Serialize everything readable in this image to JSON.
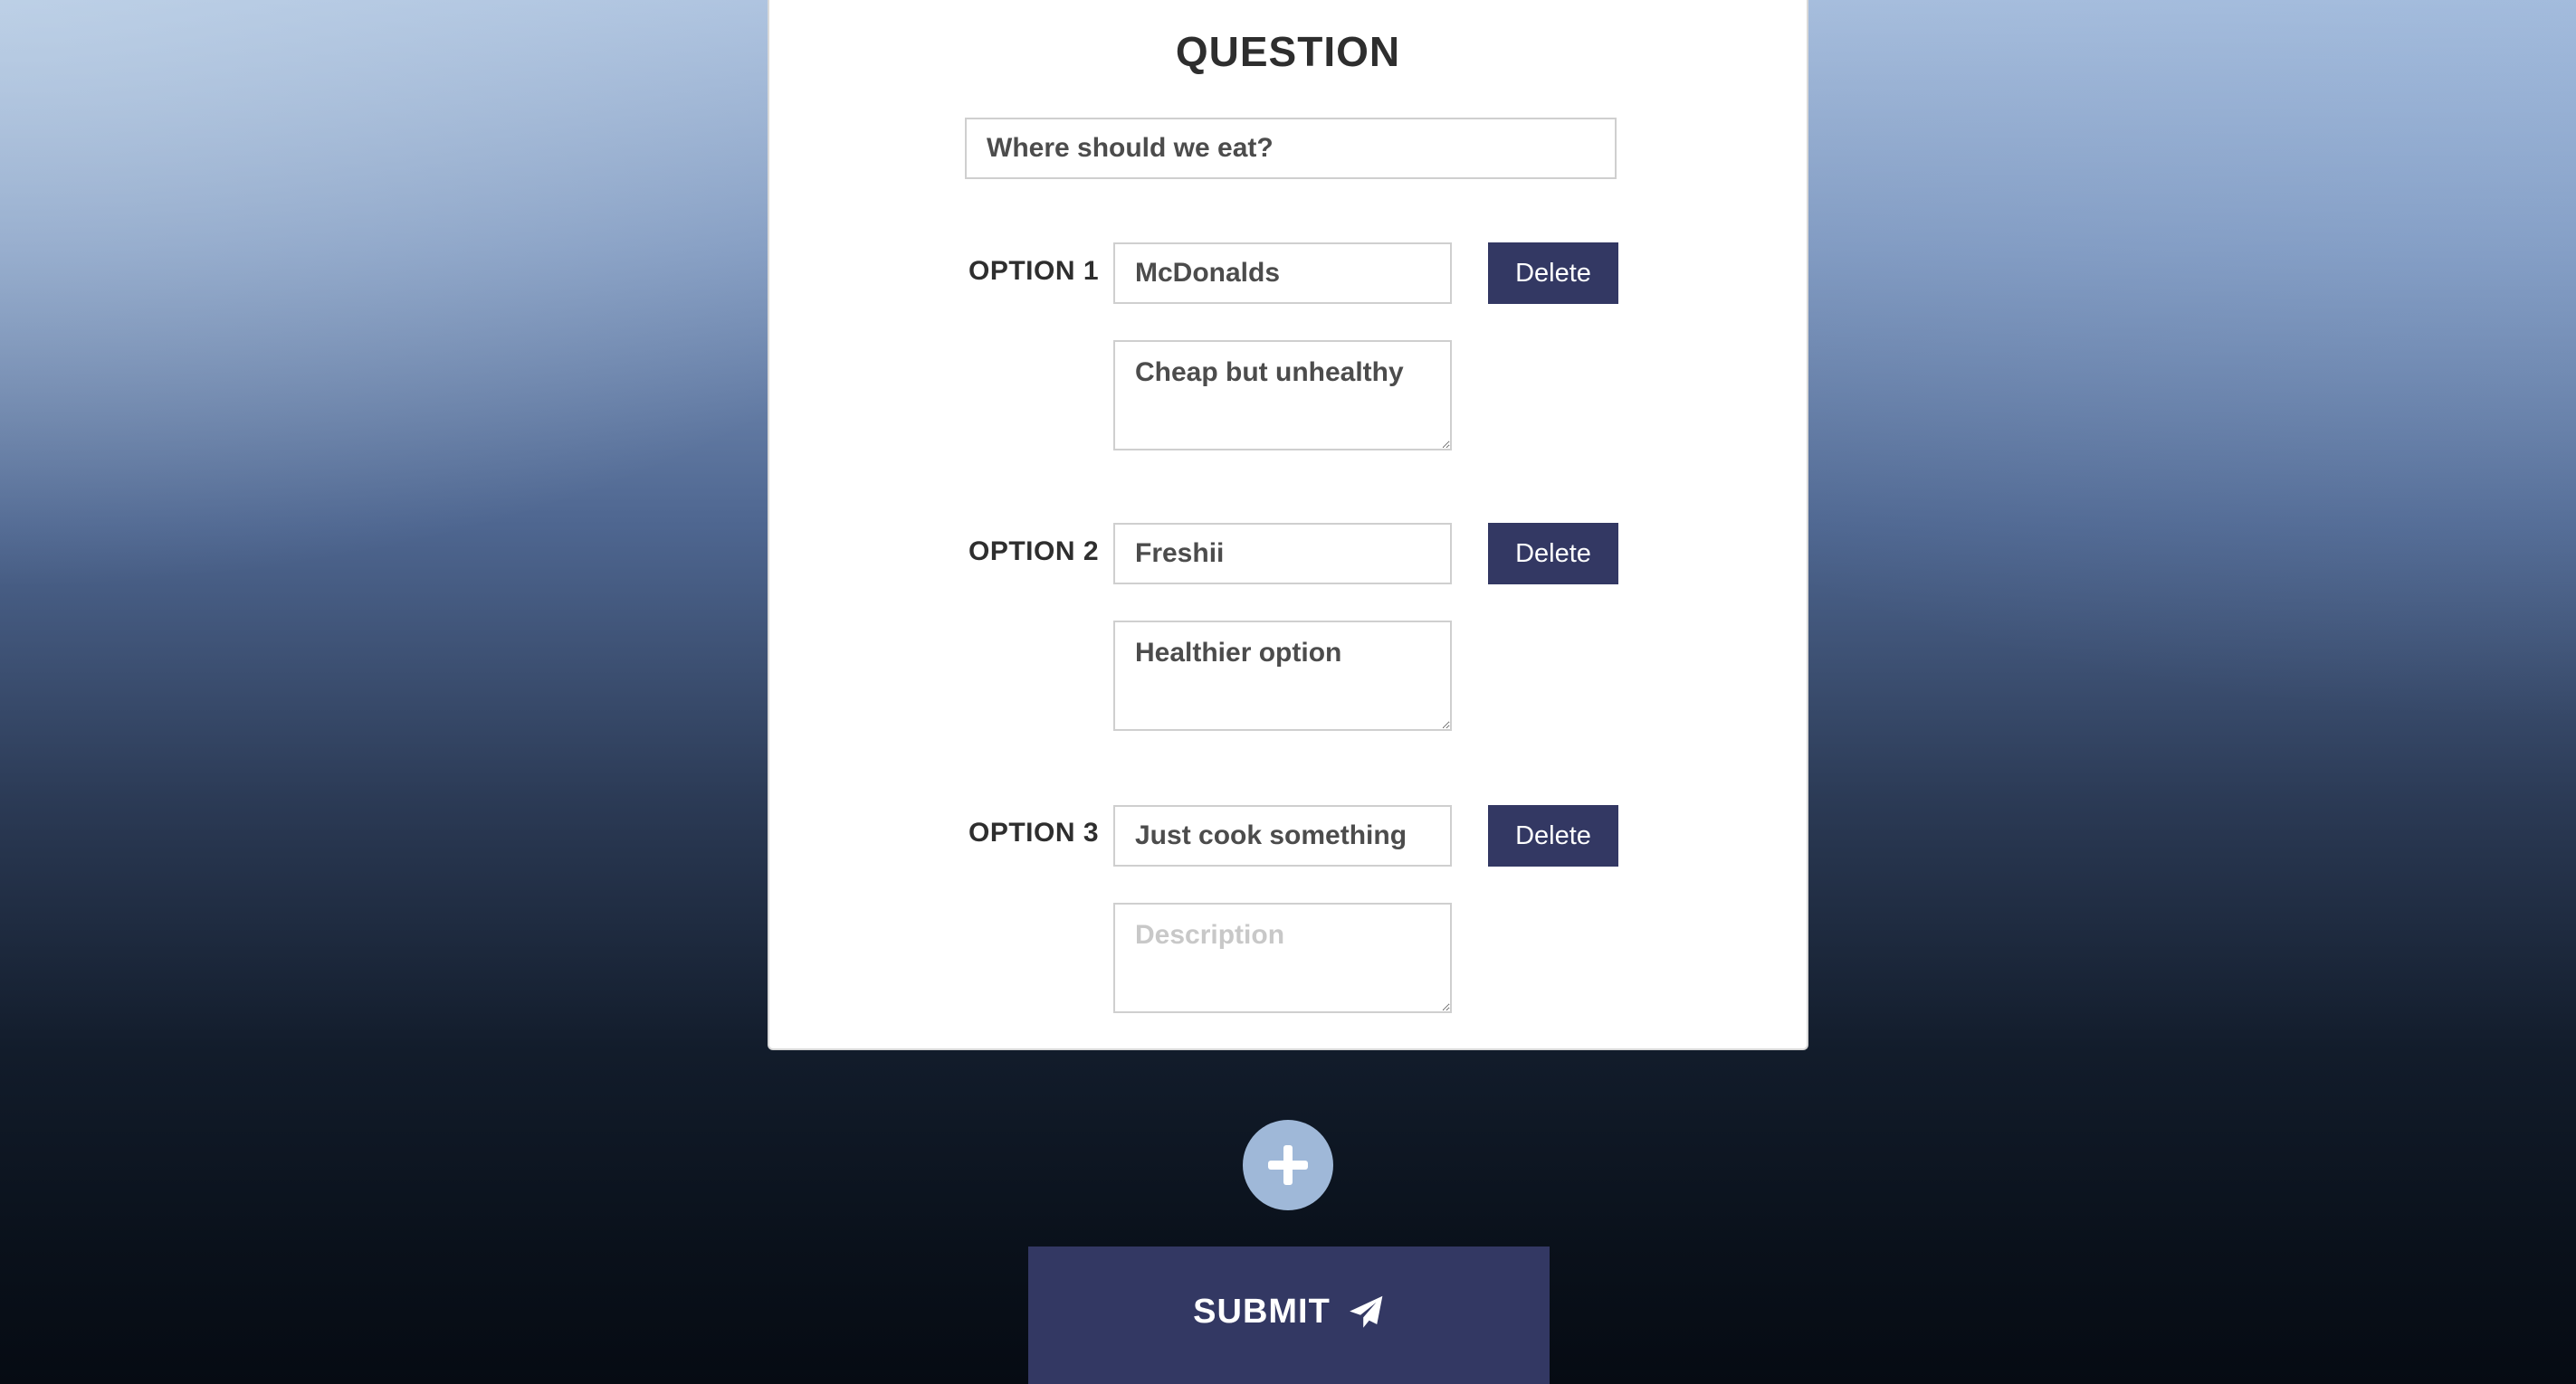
{
  "form": {
    "heading": "QUESTION",
    "question_value": "Where should we eat?"
  },
  "options": [
    {
      "label": "OPTION 1",
      "name_value": "McDonalds",
      "description_value": "Cheap but unhealthy",
      "description_placeholder": "Description",
      "delete_label": "Delete"
    },
    {
      "label": "OPTION 2",
      "name_value": "Freshii",
      "description_value": "Healthier option",
      "description_placeholder": "Description",
      "delete_label": "Delete"
    },
    {
      "label": "OPTION 3",
      "name_value": "Just cook something",
      "description_value": "",
      "description_placeholder": "Description",
      "delete_label": "Delete"
    }
  ],
  "actions": {
    "add_icon": "plus-icon",
    "submit_label": "SUBMIT",
    "submit_icon": "paper-plane-icon"
  },
  "colors": {
    "button_primary": "#333863",
    "add_button": "#9fb8d8",
    "card_background": "#ffffff"
  }
}
